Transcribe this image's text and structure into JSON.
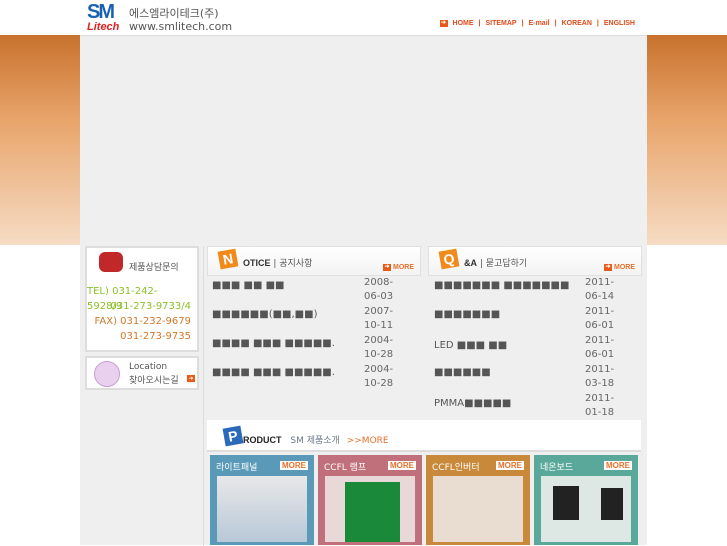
{
  "header": {
    "logo_sm": "SM",
    "logo_litech": "Litech",
    "company": "에스엠라이테크(주)",
    "url": "www.smlitech.com",
    "nav": [
      "HOME",
      "SITEMAP",
      "E-mail",
      "KOREAN",
      "ENGLISH"
    ]
  },
  "contact": {
    "title": "제품상담문의",
    "tel1": "TEL) 031-242-5928/9",
    "tel2": "031-273-9733/4",
    "fax1": "FAX) 031-232-9679",
    "fax2": "031-273-9735"
  },
  "location": {
    "title": "Location",
    "subtitle": "찾아오시는길"
  },
  "notice": {
    "badge": "N",
    "title": "OTICE",
    "subtitle": "공지사항",
    "more": "MORE",
    "items": [
      {
        "text": "■■■ ■■ ■■",
        "date": "2008-06-03"
      },
      {
        "text": "■■■■■■(■■,■■)",
        "date": "2007-10-11"
      },
      {
        "text": "■■■■ ■■■ ■■■■■.",
        "date": "2004-10-28"
      },
      {
        "text": "■■■■ ■■■ ■■■■■.",
        "date": "2004-10-28"
      }
    ]
  },
  "qa": {
    "badge": "Q",
    "title": "&A",
    "subtitle": "묻고답하기",
    "more": "MORE",
    "items": [
      {
        "text": "■■■■■■■ ■■■■■■■",
        "date": "2011-06-14"
      },
      {
        "text": "■■■■■■■",
        "date": "2011-06-01"
      },
      {
        "text": "LED ■■■ ■■",
        "date": "2011-06-01"
      },
      {
        "text": "■■■■■■",
        "date": "2011-03-18"
      },
      {
        "text": "PMMA■■■■■",
        "date": "2011-01-18"
      }
    ]
  },
  "product": {
    "badge": "P",
    "title": "RODUCT",
    "subtitle": "SM 제품소개",
    "more": ">>MORE",
    "items": [
      {
        "label": "라이트패널",
        "more": "MORE",
        "color": "#5a9ab8"
      },
      {
        "label": "CCFL 램프",
        "more": "MORE",
        "color": "#c0707a"
      },
      {
        "label": "CCFL인버터",
        "more": "MORE",
        "color": "#c88a3a"
      },
      {
        "label": "네온보드",
        "more": "MORE",
        "color": "#5aa89a"
      }
    ]
  }
}
